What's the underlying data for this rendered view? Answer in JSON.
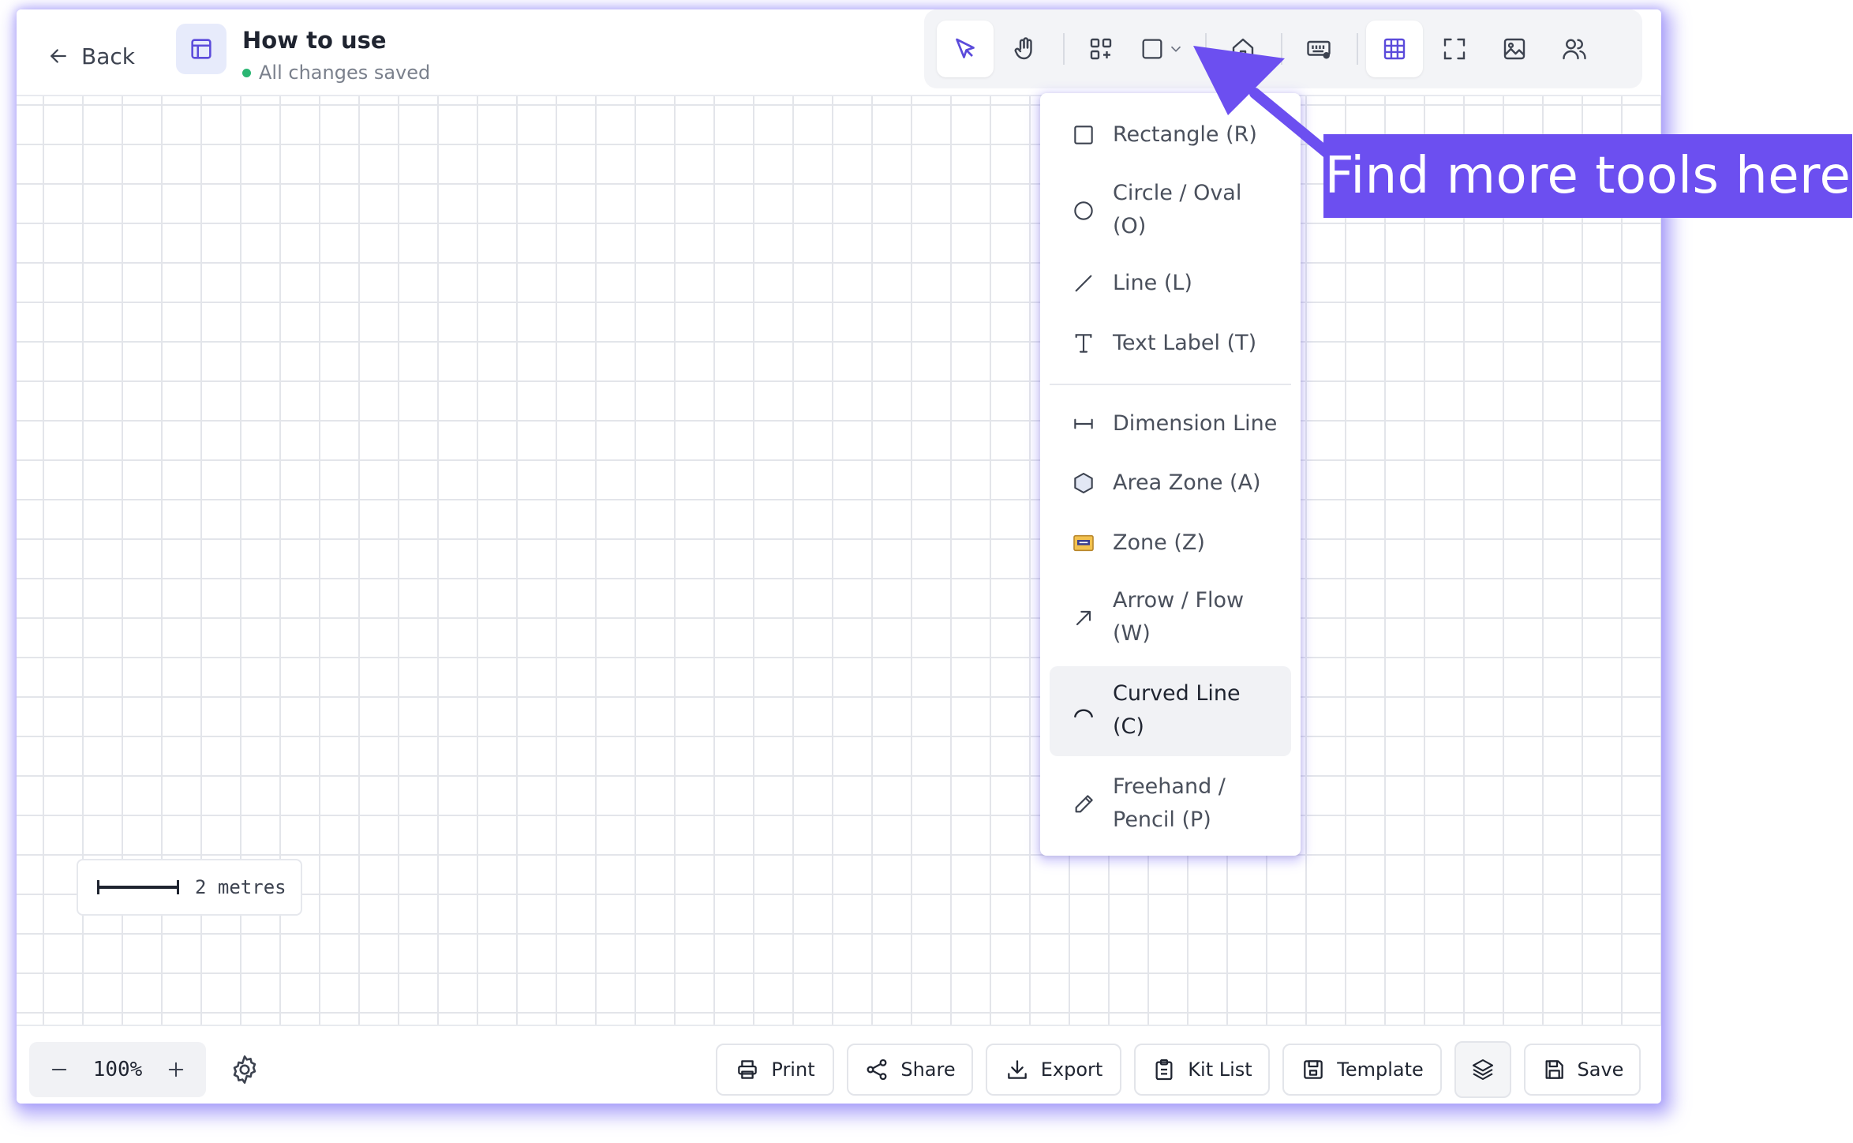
{
  "header": {
    "back_label": "Back",
    "doc_title": "How to use",
    "doc_status": "All changes saved"
  },
  "toolbar": {
    "tools": [
      "select-tool",
      "pan-tool",
      "components-tool",
      "shapes-tool",
      "home-tool",
      "keyboard-tool",
      "grid-toggle",
      "fullscreen",
      "image-tool",
      "collaborators"
    ],
    "active_color": "#5b4bdb"
  },
  "dropdown": {
    "items": [
      {
        "label": "Rectangle (R)",
        "icon": "square-icon"
      },
      {
        "label": "Circle / Oval (O)",
        "icon": "circle-icon"
      },
      {
        "label": "Line (L)",
        "icon": "line-icon"
      },
      {
        "label": "Text Label (T)",
        "icon": "text-icon"
      },
      {
        "label": "Dimension Line",
        "icon": "dimension-icon"
      },
      {
        "label": "Area Zone (A)",
        "icon": "hexagon-icon"
      },
      {
        "label": "Zone (Z)",
        "icon": "zone-icon"
      },
      {
        "label": "Arrow / Flow (W)",
        "icon": "arrow-up-right-icon"
      },
      {
        "label": "Curved Line (C)",
        "icon": "curve-icon"
      },
      {
        "label": "Freehand / Pencil (P)",
        "icon": "pencil-icon"
      }
    ],
    "highlighted": "Curved Line (C)"
  },
  "canvas": {
    "scale_label": "2 metres"
  },
  "bottombar": {
    "zoom_value": "100%",
    "print_label": "Print",
    "share_label": "Share",
    "export_label": "Export",
    "kit_list_label": "Kit List",
    "template_label": "Template",
    "save_label": "Save"
  },
  "callout": {
    "text": "Find more tools here",
    "color": "#6c4ff0"
  }
}
